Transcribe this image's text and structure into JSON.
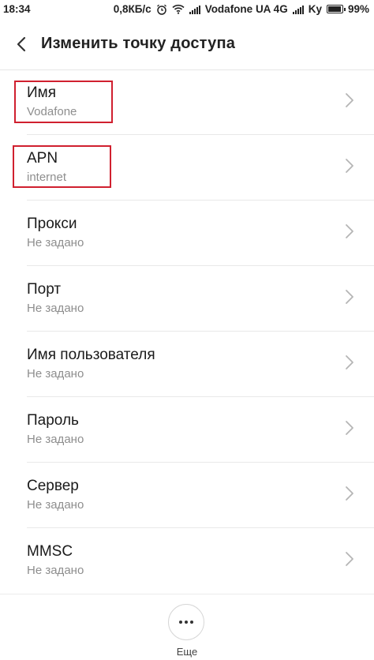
{
  "status_bar": {
    "time": "18:34",
    "speed": "0,8КБ/с",
    "carrier1": "Vodafone UA 4G",
    "carrier2": "Ky",
    "battery": "99%",
    "battery_level": 0.99,
    "icons": [
      "alarm-icon",
      "wifi-icon",
      "signal-icon",
      "signal-icon",
      "battery-icon"
    ]
  },
  "header": {
    "title": "Изменить точку доступа",
    "back_icon": "chevron-left-icon"
  },
  "items": [
    {
      "label": "Имя",
      "value": "Vodafone",
      "highlighted": true
    },
    {
      "label": "APN",
      "value": "internet",
      "highlighted": true
    },
    {
      "label": "Прокси",
      "value": "Не задано",
      "highlighted": false
    },
    {
      "label": "Порт",
      "value": "Не задано",
      "highlighted": false
    },
    {
      "label": "Имя пользователя",
      "value": "Не задано",
      "highlighted": false
    },
    {
      "label": "Пароль",
      "value": "Не задано",
      "highlighted": false
    },
    {
      "label": "Сервер",
      "value": "Не задано",
      "highlighted": false
    },
    {
      "label": "MMSC",
      "value": "Не задано",
      "highlighted": false
    }
  ],
  "footer": {
    "more_label": "Еще",
    "more_icon": "more-dots-icon"
  },
  "colors": {
    "highlight": "#d0202f",
    "secondary_text": "#8e8e8e",
    "divider": "#e8e8e8"
  }
}
